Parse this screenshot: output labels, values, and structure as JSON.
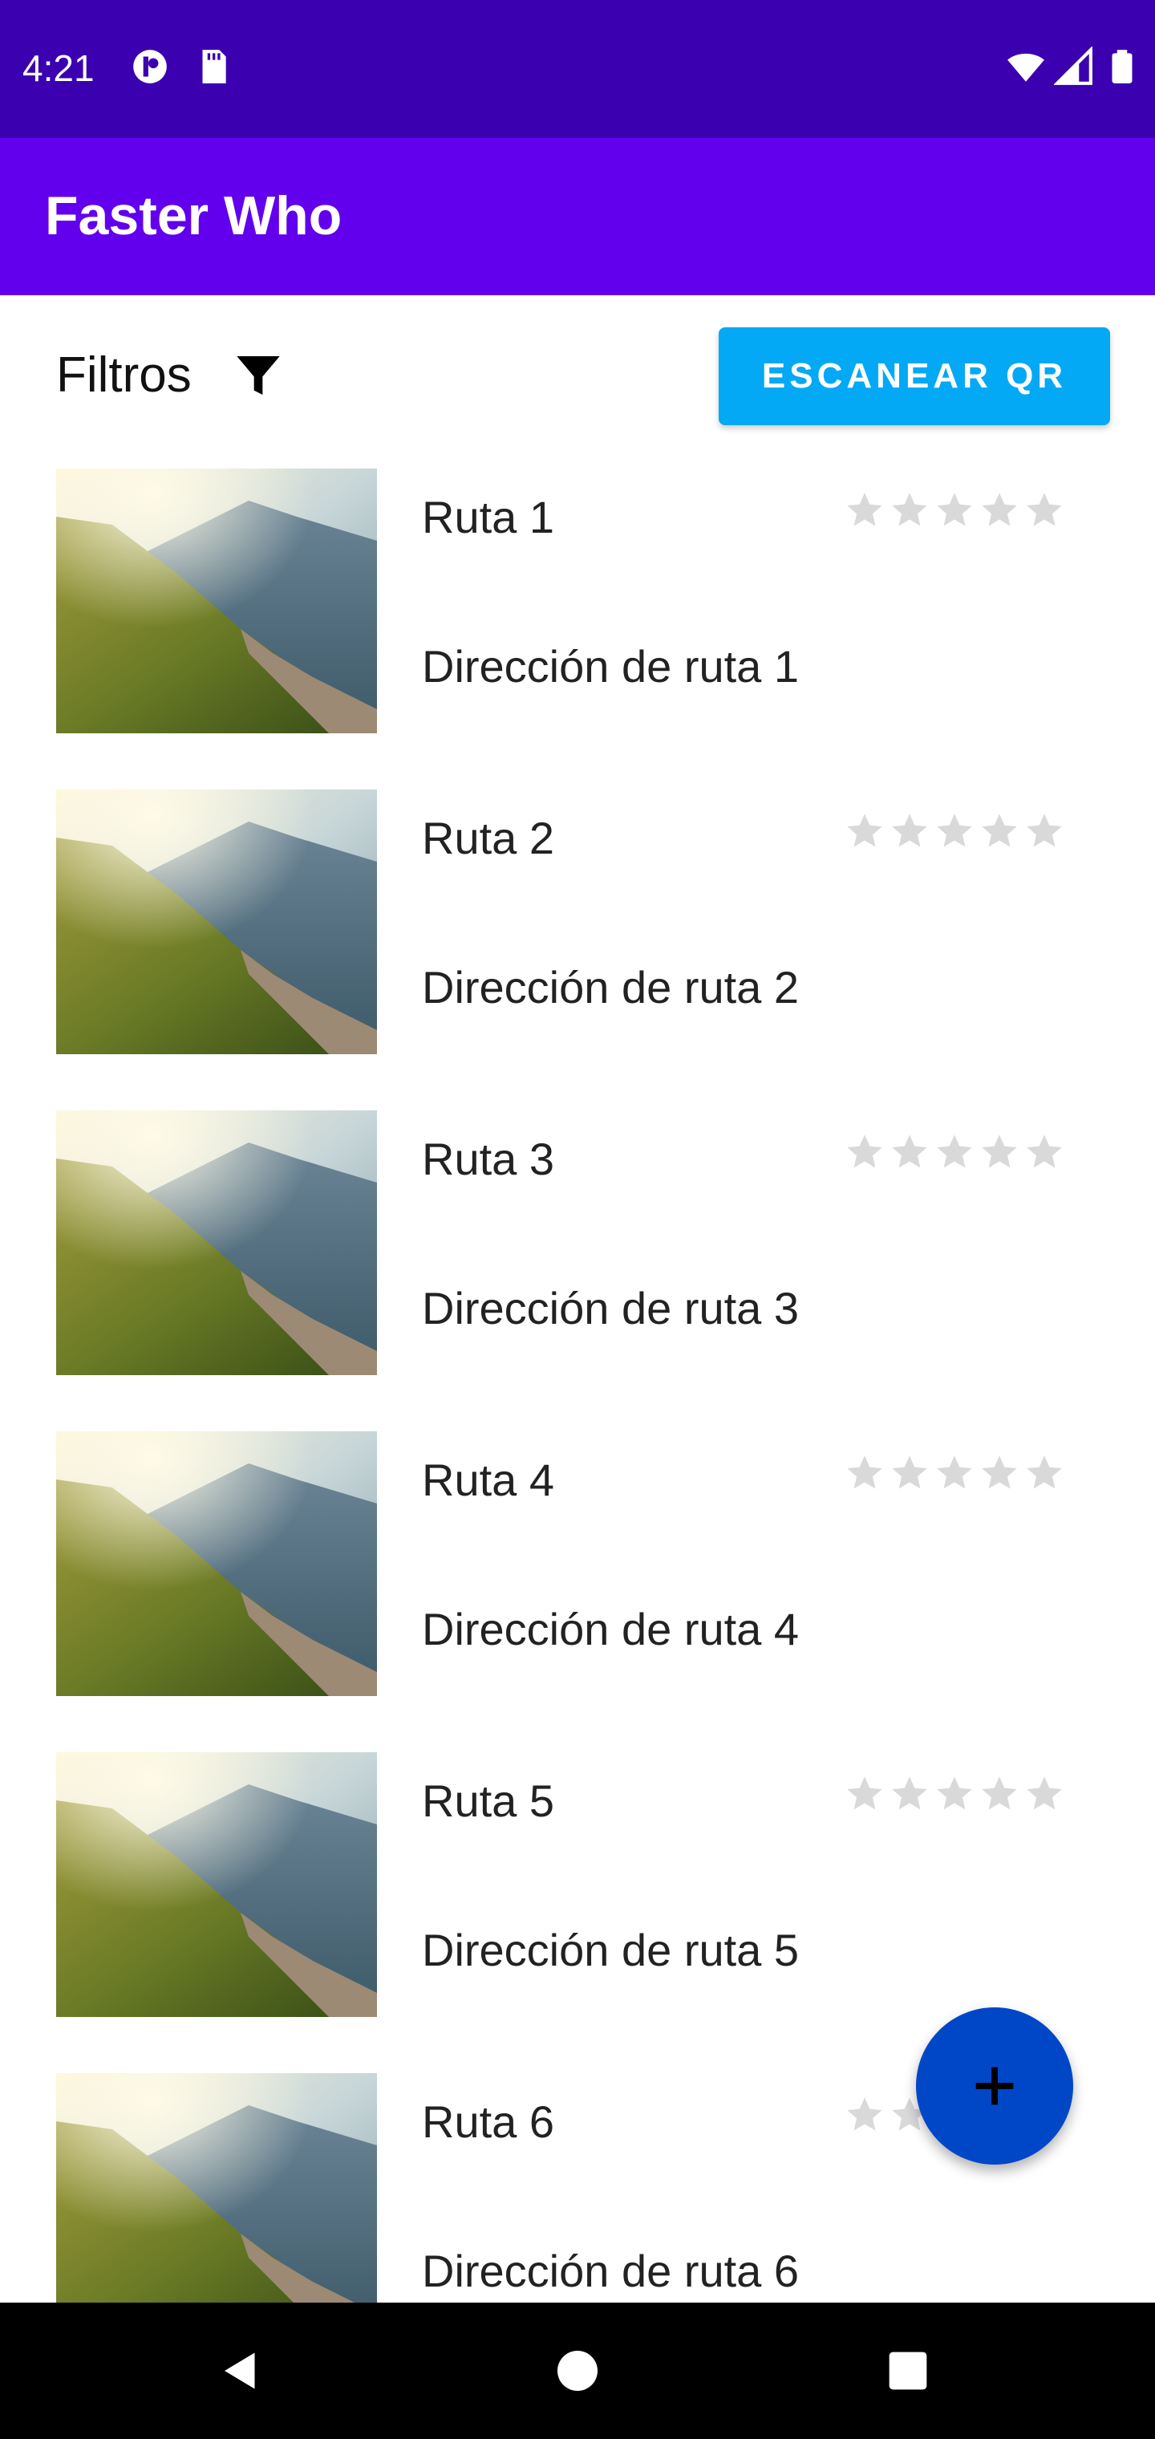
{
  "status": {
    "time": "4:21"
  },
  "app": {
    "title": "Faster Who"
  },
  "toolbar": {
    "filters_label": "Filtros",
    "scan_label": "ESCANEAR QR"
  },
  "routes": [
    {
      "title": "Ruta 1",
      "address": "Dirección de ruta 1",
      "rating": 0
    },
    {
      "title": "Ruta 2",
      "address": "Dirección de ruta 2",
      "rating": 0
    },
    {
      "title": "Ruta 3",
      "address": "Dirección de ruta 3",
      "rating": 0
    },
    {
      "title": "Ruta 4",
      "address": "Dirección de ruta 4",
      "rating": 0
    },
    {
      "title": "Ruta 5",
      "address": "Dirección de ruta 5",
      "rating": 0
    },
    {
      "title": "Ruta 6",
      "address": "Dirección de ruta 6",
      "rating": 0
    }
  ],
  "colors": {
    "status_bar": "#3b00b0",
    "app_bar": "#6200ee",
    "scan_button": "#03a9f4",
    "fab": "#0047c8",
    "star_empty": "#d9d9d9"
  },
  "icons": [
    "filter-icon",
    "star-icon",
    "add-icon",
    "back-icon",
    "home-icon",
    "recents-icon",
    "wifi-icon",
    "signal-icon",
    "battery-icon",
    "sd-card-icon",
    "notification-icon"
  ]
}
